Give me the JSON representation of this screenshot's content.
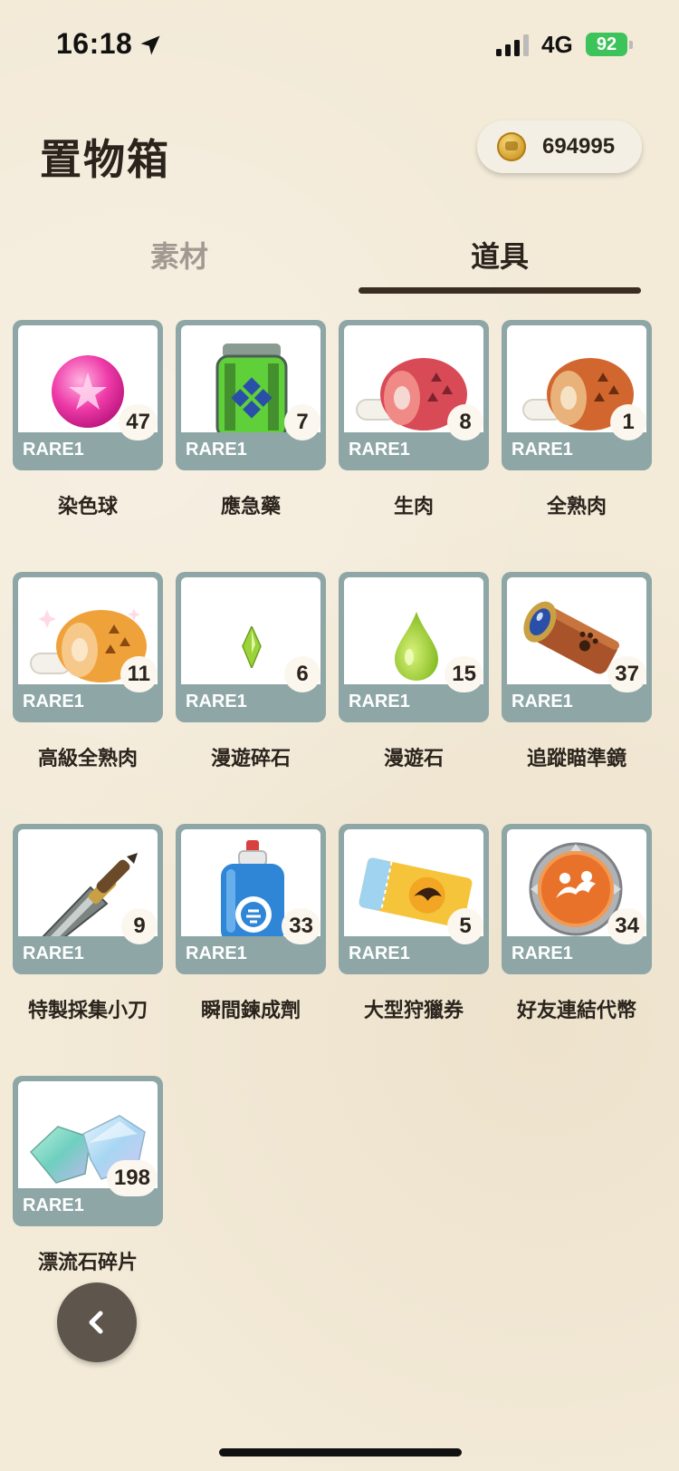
{
  "status_bar": {
    "time": "16:18",
    "network": "4G",
    "battery": "92"
  },
  "header": {
    "title": "置物箱",
    "coins": "694995",
    "coin_icon": "gold-coin-icon"
  },
  "tabs": [
    {
      "label": "素材",
      "active": false
    },
    {
      "label": "道具",
      "active": true
    }
  ],
  "items": [
    {
      "name": "染色球",
      "rarity": "RARE1",
      "count": "47",
      "icon": "dye-ball-icon"
    },
    {
      "name": "應急藥",
      "rarity": "RARE1",
      "count": "7",
      "icon": "first-aid-potion-icon"
    },
    {
      "name": "生肉",
      "rarity": "RARE1",
      "count": "8",
      "icon": "raw-meat-icon"
    },
    {
      "name": "全熟肉",
      "rarity": "RARE1",
      "count": "1",
      "icon": "well-done-meat-icon"
    },
    {
      "name": "高級全熟肉",
      "rarity": "RARE1",
      "count": "11",
      "icon": "premium-well-done-meat-icon"
    },
    {
      "name": "漫遊碎石",
      "rarity": "RARE1",
      "count": "6",
      "icon": "wander-shard-icon"
    },
    {
      "name": "漫遊石",
      "rarity": "RARE1",
      "count": "15",
      "icon": "wander-stone-icon"
    },
    {
      "name": "追蹤瞄準鏡",
      "rarity": "RARE1",
      "count": "37",
      "icon": "tracking-scope-icon"
    },
    {
      "name": "特製採集小刀",
      "rarity": "RARE1",
      "count": "9",
      "icon": "gathering-knife-icon"
    },
    {
      "name": "瞬間鍊成劑",
      "rarity": "RARE1",
      "count": "33",
      "icon": "instant-crafting-agent-icon"
    },
    {
      "name": "大型狩獵券",
      "rarity": "RARE1",
      "count": "5",
      "icon": "large-hunt-ticket-icon"
    },
    {
      "name": "好友連結代幣",
      "rarity": "RARE1",
      "count": "34",
      "icon": "friend-link-token-icon"
    },
    {
      "name": "漂流石碎片",
      "rarity": "RARE1",
      "count": "198",
      "icon": "drift-stone-fragment-icon"
    }
  ],
  "navigation": {
    "back_icon": "chevron-left-icon"
  },
  "colors": {
    "background": "#f3ead8",
    "card_frame": "#8ea6a6",
    "tab_active": "#3a2e22",
    "tab_inactive": "#a09a92"
  }
}
